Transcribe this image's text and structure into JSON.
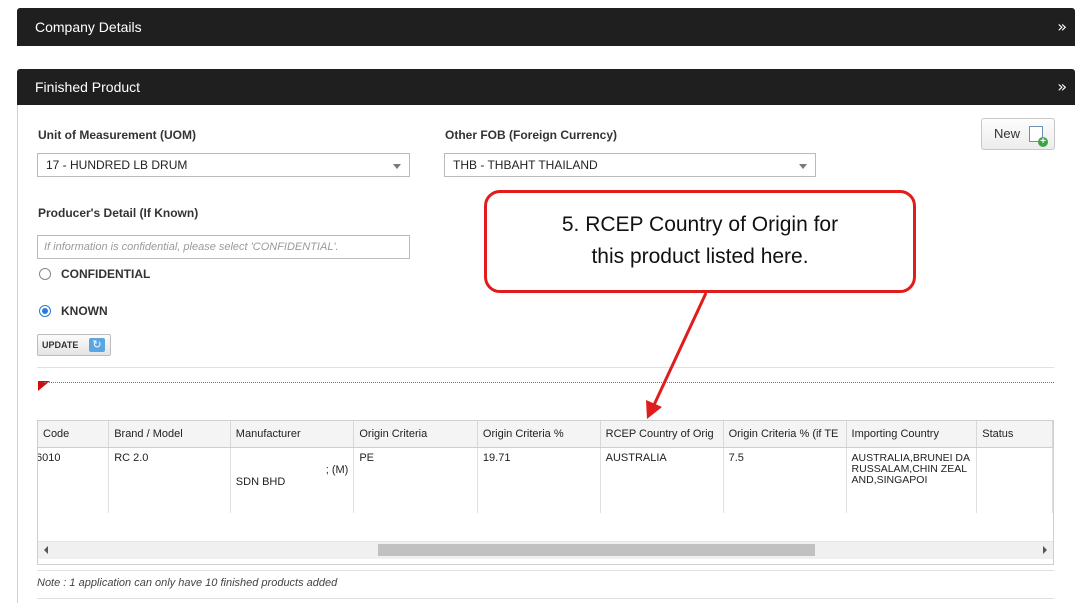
{
  "panels": {
    "company": {
      "title": "Company Details",
      "collapse_icon": "double-chevron-down-icon"
    },
    "finished": {
      "title": "Finished Product",
      "collapse_icon": "double-chevron-down-icon"
    }
  },
  "form": {
    "uom_label": "Unit of Measurement (UOM)",
    "uom_value": "17 - HUNDRED LB DRUM",
    "fob_label": "Other FOB (Foreign Currency)",
    "fob_value": "THB - THBAHT THAILAND",
    "new_label": "New",
    "producer_label": "Producer's Detail (If Known)",
    "producer_placeholder": "If information is confidential, please select 'CONFIDENTIAL'.",
    "confidential_label": "CONFIDENTIAL",
    "known_label": "KNOWN",
    "known_selected": true,
    "update_label": "UPDATE"
  },
  "table": {
    "columns": [
      "Code",
      "Brand / Model",
      "Manufacturer",
      "Origin Criteria",
      "Origin Criteria %",
      "RCEP Country of Orig",
      "Origin Criteria % (if TE",
      "Importing Country",
      "Status"
    ],
    "row": {
      "code": "6010",
      "brand": "RC 2.0",
      "manufacturer_a": "; (M)",
      "manufacturer_b": "SDN BHD",
      "origin_criteria": "PE",
      "origin_pct": "19.71",
      "rcep_country": "AUSTRALIA",
      "origin_pct_te": "7.5",
      "importing_country": "AUSTRALIA,BRUNEI DARUSSALAM,CHIN ZEALAND,SINGAPOI",
      "status": ""
    }
  },
  "note": "Note : 1 application can only have 10 finished products added",
  "callout": {
    "line1": "5. RCEP Country of Origin for",
    "line2": "this product listed here.",
    "color": "#e01c1c"
  }
}
